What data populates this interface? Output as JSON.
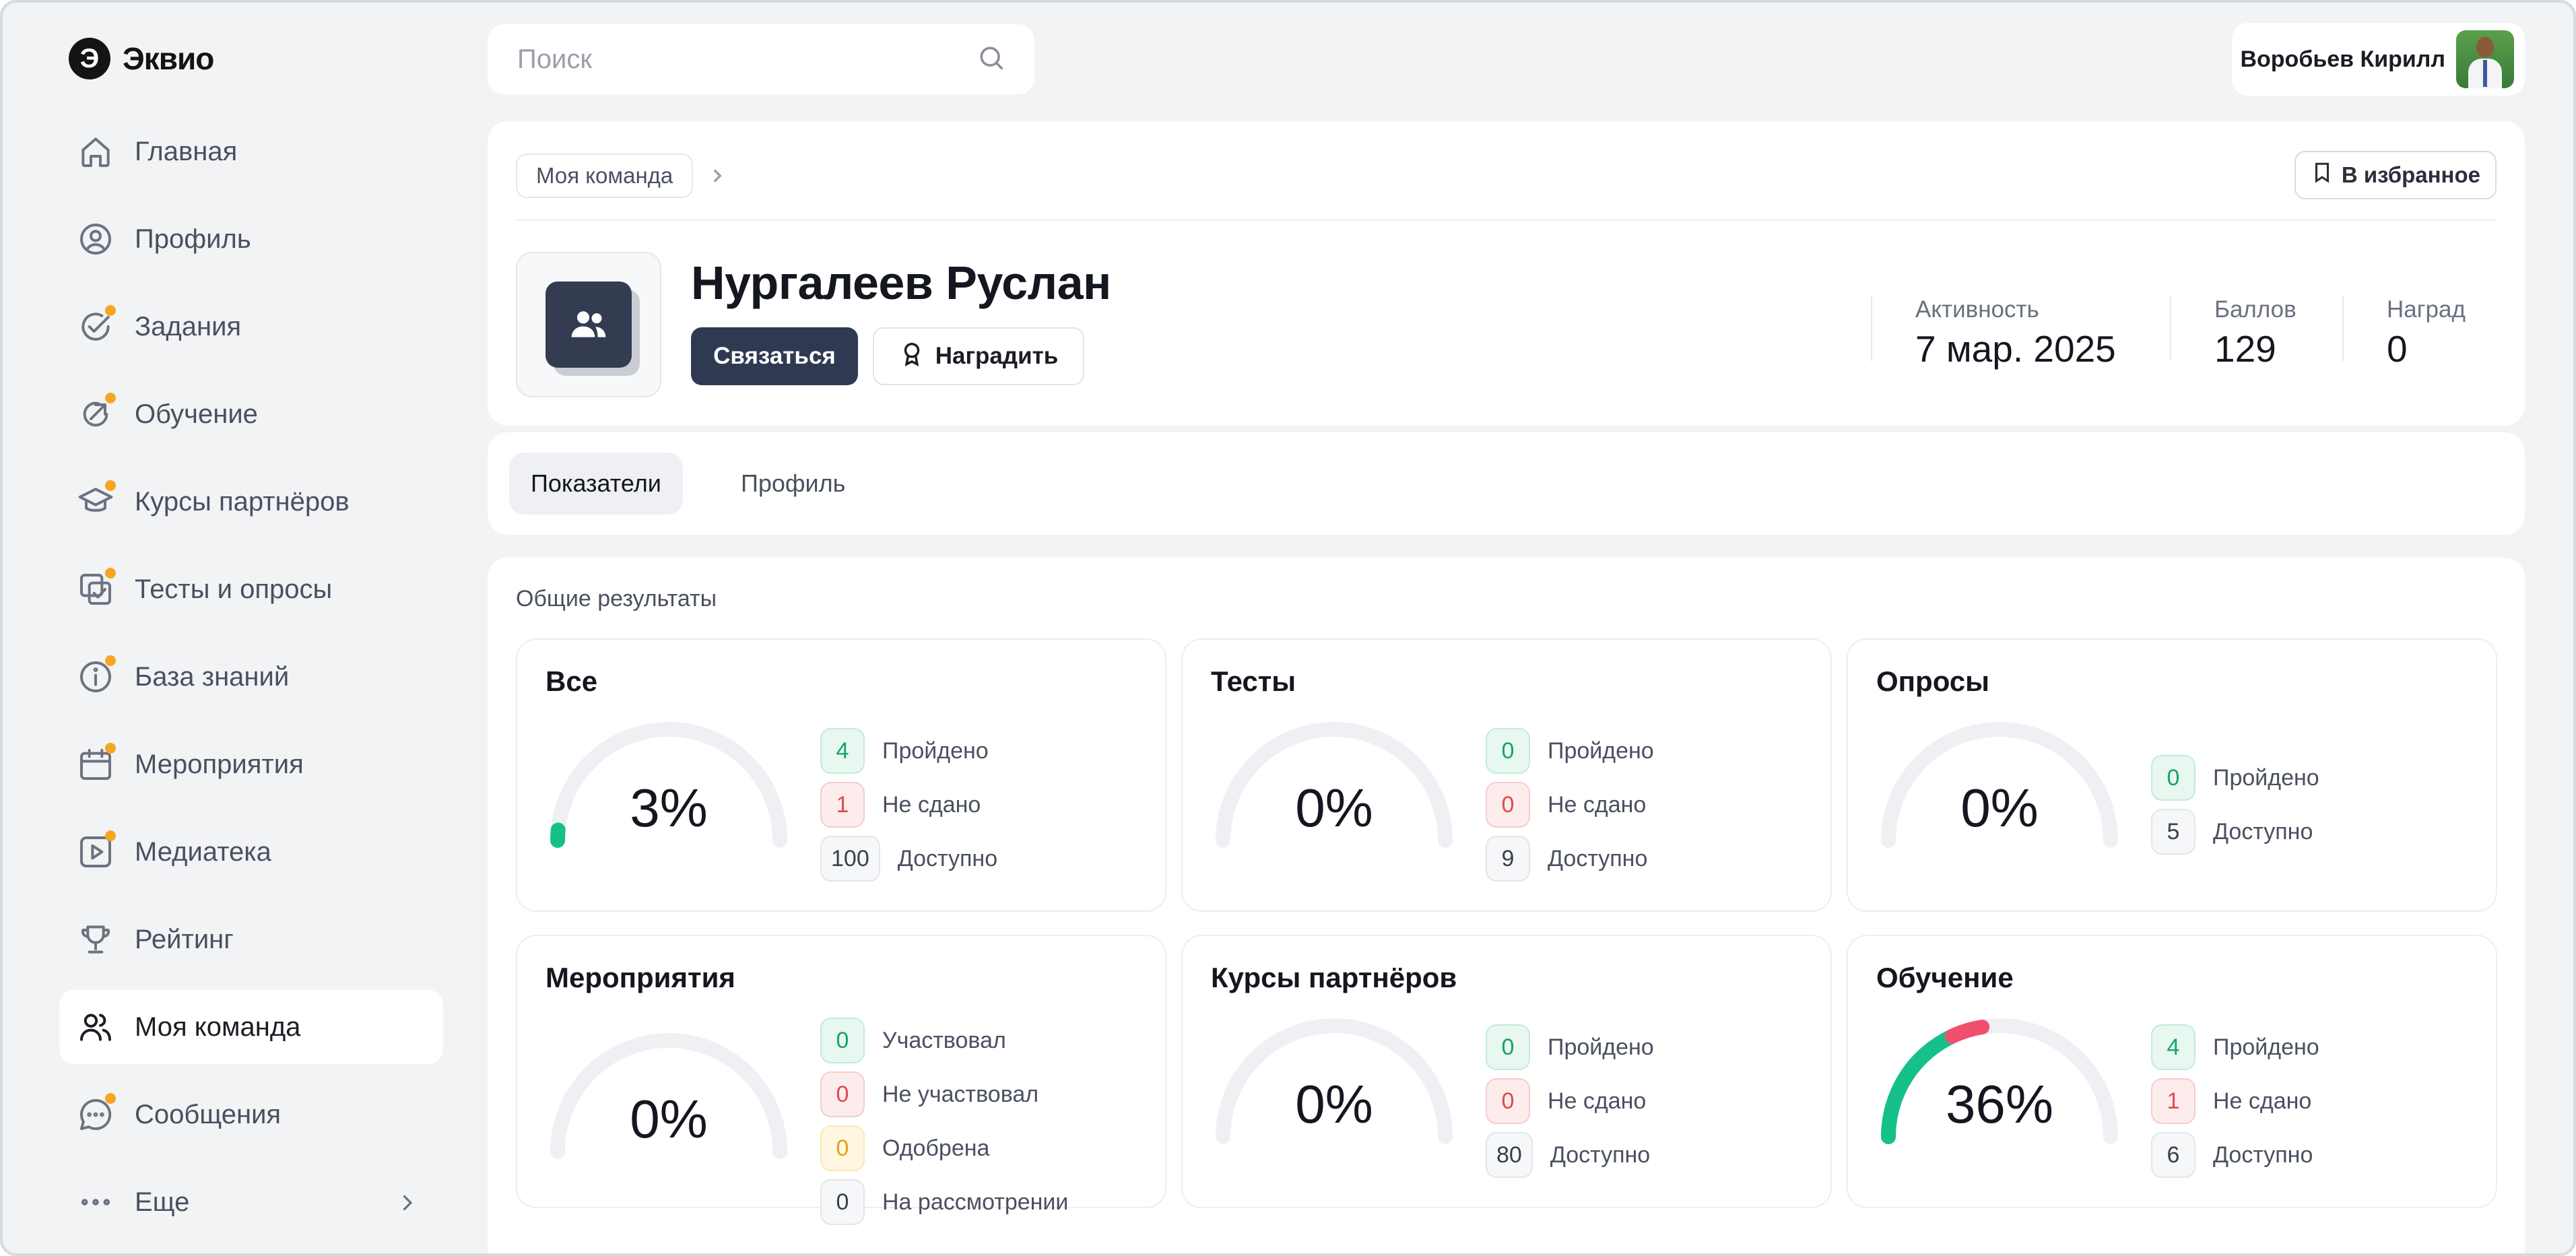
{
  "brand": {
    "logo_text": "Эквио",
    "logo_glyph": "Э"
  },
  "search": {
    "placeholder": "Поиск"
  },
  "user": {
    "name": "Воробьев Кирилл"
  },
  "sidebar": {
    "items": [
      {
        "label": "Главная",
        "icon": "home-icon",
        "dot": false
      },
      {
        "label": "Профиль",
        "icon": "user-circle-icon",
        "dot": false
      },
      {
        "label": "Задания",
        "icon": "check-circle-icon",
        "dot": true
      },
      {
        "label": "Обучение",
        "icon": "arrow-circle-icon",
        "dot": true
      },
      {
        "label": "Курсы партнёров",
        "icon": "graduation-cap-icon",
        "dot": true
      },
      {
        "label": "Тесты и опросы",
        "icon": "checklist-icon",
        "dot": true
      },
      {
        "label": "База знаний",
        "icon": "info-circle-icon",
        "dot": true
      },
      {
        "label": "Мероприятия",
        "icon": "calendar-icon",
        "dot": true
      },
      {
        "label": "Медиатека",
        "icon": "play-square-icon",
        "dot": true
      },
      {
        "label": "Рейтинг",
        "icon": "trophy-icon",
        "dot": false
      },
      {
        "label": "Моя команда",
        "icon": "users-icon",
        "dot": false,
        "active": true
      },
      {
        "label": "Сообщения",
        "icon": "chat-icon",
        "dot": true
      },
      {
        "label": "Еще",
        "icon": "more-icon",
        "dot": false
      }
    ]
  },
  "profile": {
    "breadcrumb": "Моя команда",
    "favorite_label": "В избранное",
    "name": "Нургалеев Руслан",
    "contact_label": "Связаться",
    "reward_label": "Наградить",
    "stats": [
      {
        "label": "Активность",
        "value": "7 мар. 2025"
      },
      {
        "label": "Баллов",
        "value": "129"
      },
      {
        "label": "Наград",
        "value": "0"
      }
    ]
  },
  "tabs": [
    {
      "label": "Показатели",
      "active": true
    },
    {
      "label": "Профиль",
      "active": false
    }
  ],
  "results": {
    "title": "Общие результаты",
    "cards": [
      {
        "title": "Все",
        "percent_label": "3%",
        "passed": 0.03,
        "failed": 0,
        "rows": [
          {
            "value": "4",
            "label": "Пройдено",
            "tone": "green"
          },
          {
            "value": "1",
            "label": "Не сдано",
            "tone": "red"
          },
          {
            "value": "100",
            "label": "Доступно",
            "tone": "gray"
          }
        ]
      },
      {
        "title": "Тесты",
        "percent_label": "0%",
        "passed": 0,
        "failed": 0,
        "rows": [
          {
            "value": "0",
            "label": "Пройдено",
            "tone": "green"
          },
          {
            "value": "0",
            "label": "Не сдано",
            "tone": "red"
          },
          {
            "value": "9",
            "label": "Доступно",
            "tone": "gray"
          }
        ]
      },
      {
        "title": "Опросы",
        "percent_label": "0%",
        "passed": 0,
        "failed": 0,
        "rows": [
          {
            "value": "0",
            "label": "Пройдено",
            "tone": "green"
          },
          {
            "value": "5",
            "label": "Доступно",
            "tone": "gray"
          }
        ]
      },
      {
        "title": "Мероприятия",
        "percent_label": "0%",
        "passed": 0,
        "failed": 0,
        "rows": [
          {
            "value": "0",
            "label": "Участвовал",
            "tone": "green"
          },
          {
            "value": "0",
            "label": "Не участвовал",
            "tone": "red"
          },
          {
            "value": "0",
            "label": "Одобрена",
            "tone": "yellow"
          },
          {
            "value": "0",
            "label": "На рассмотрении",
            "tone": "gray"
          }
        ]
      },
      {
        "title": "Курсы партнёров",
        "percent_label": "0%",
        "passed": 0,
        "failed": 0,
        "rows": [
          {
            "value": "0",
            "label": "Пройдено",
            "tone": "green"
          },
          {
            "value": "0",
            "label": "Не сдано",
            "tone": "red"
          },
          {
            "value": "80",
            "label": "Доступно",
            "tone": "gray"
          }
        ]
      },
      {
        "title": "Обучение",
        "percent_label": "36%",
        "passed": 0.36,
        "failed": 0.09,
        "rows": [
          {
            "value": "4",
            "label": "Пройдено",
            "tone": "green"
          },
          {
            "value": "1",
            "label": "Не сдано",
            "tone": "red"
          },
          {
            "value": "6",
            "label": "Доступно",
            "tone": "gray"
          }
        ]
      }
    ]
  },
  "colors": {
    "accent_dark": "#2f3a52",
    "success": "#16c08a",
    "danger": "#f0506e",
    "dot": "#f5a623"
  }
}
